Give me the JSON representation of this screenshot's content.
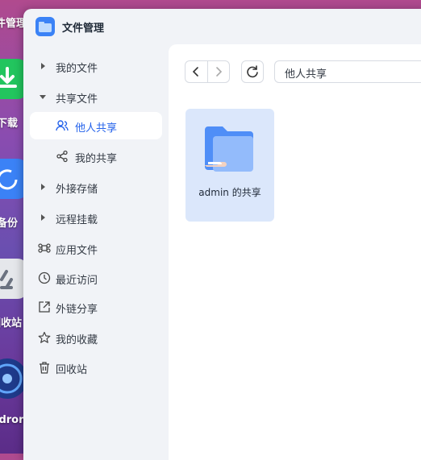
{
  "desktop": {
    "icons": [
      {
        "name": "file-manager",
        "label": "件管理"
      },
      {
        "name": "download",
        "label": "下载"
      },
      {
        "name": "backup",
        "label": "备份"
      },
      {
        "name": "recycle",
        "label": "回收站"
      },
      {
        "name": "media",
        "label": "idron"
      }
    ]
  },
  "window": {
    "title": "文件管理"
  },
  "sidebar": {
    "items": [
      {
        "label": "我的文件"
      },
      {
        "label": "共享文件"
      },
      {
        "label": "他人共享"
      },
      {
        "label": "我的共享"
      },
      {
        "label": "外接存储"
      },
      {
        "label": "远程挂载"
      },
      {
        "label": "应用文件"
      },
      {
        "label": "最近访问"
      },
      {
        "label": "外链分享"
      },
      {
        "label": "我的收藏"
      },
      {
        "label": "回收站"
      }
    ]
  },
  "toolbar": {
    "path": "他人共享"
  },
  "files": [
    {
      "name": "admin 的共享"
    }
  ],
  "colors": {
    "accent": "#2563eb",
    "folder_card": "#dbe7fb",
    "sidebar_bg": "#f1f3f7"
  }
}
